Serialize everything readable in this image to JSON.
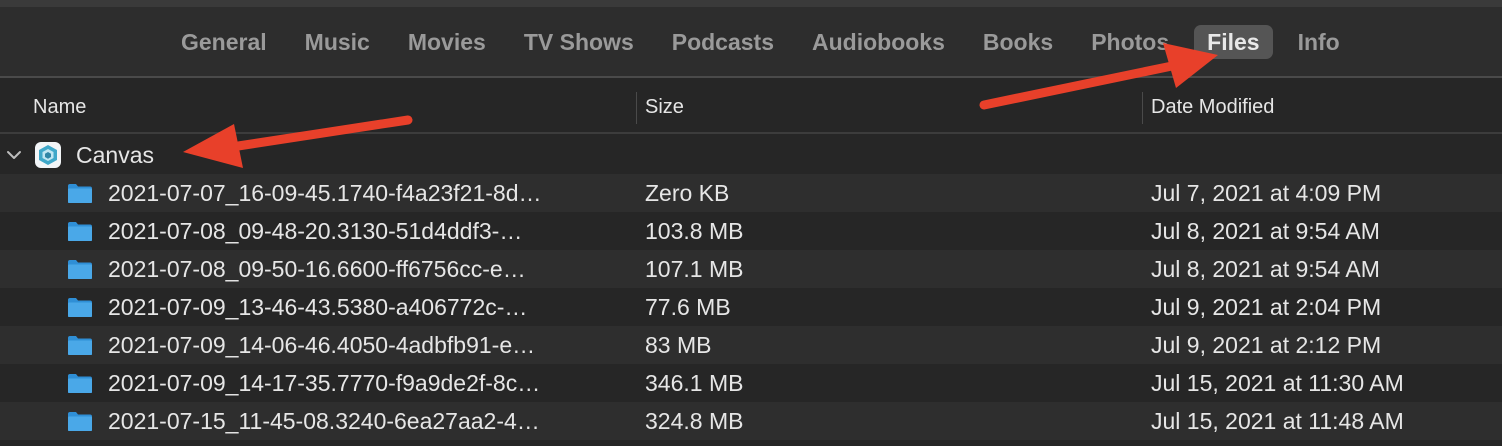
{
  "tabs": [
    {
      "label": "General",
      "active": false
    },
    {
      "label": "Music",
      "active": false
    },
    {
      "label": "Movies",
      "active": false
    },
    {
      "label": "TV Shows",
      "active": false
    },
    {
      "label": "Podcasts",
      "active": false
    },
    {
      "label": "Audiobooks",
      "active": false
    },
    {
      "label": "Books",
      "active": false
    },
    {
      "label": "Photos",
      "active": false
    },
    {
      "label": "Files",
      "active": true
    },
    {
      "label": "Info",
      "active": false
    }
  ],
  "columns": {
    "name": "Name",
    "size": "Size",
    "date": "Date Modified"
  },
  "app_group": {
    "name": "Canvas",
    "icon": "canvas-app-icon",
    "expanded": true
  },
  "files": [
    {
      "name": "2021-07-07_16-09-45.1740-f4a23f21-8d…",
      "size": "Zero KB",
      "date": "Jul 7, 2021 at 4:09 PM"
    },
    {
      "name": "2021-07-08_09-48-20.3130-51d4ddf3-…",
      "size": "103.8 MB",
      "date": "Jul 8, 2021 at 9:54 AM"
    },
    {
      "name": "2021-07-08_09-50-16.6600-ff6756cc-e…",
      "size": "107.1 MB",
      "date": "Jul 8, 2021 at 9:54 AM"
    },
    {
      "name": "2021-07-09_13-46-43.5380-a406772c-…",
      "size": "77.6 MB",
      "date": "Jul 9, 2021 at 2:04 PM"
    },
    {
      "name": "2021-07-09_14-06-46.4050-4adbfb91-e…",
      "size": "83 MB",
      "date": "Jul 9, 2021 at 2:12 PM"
    },
    {
      "name": "2021-07-09_14-17-35.7770-f9a9de2f-8c…",
      "size": "346.1 MB",
      "date": "Jul 15, 2021 at 11:30 AM"
    },
    {
      "name": "2021-07-15_11-45-08.3240-6ea27aa2-4…",
      "size": "324.8 MB",
      "date": "Jul 15, 2021 at 11:48 AM"
    }
  ],
  "colors": {
    "folder": "#4aa8e8",
    "annotation_arrow": "#e8402a",
    "active_tab_bg": "#555555"
  },
  "icons": {
    "disclosure": "chevron-down-icon",
    "folder": "folder-icon"
  }
}
